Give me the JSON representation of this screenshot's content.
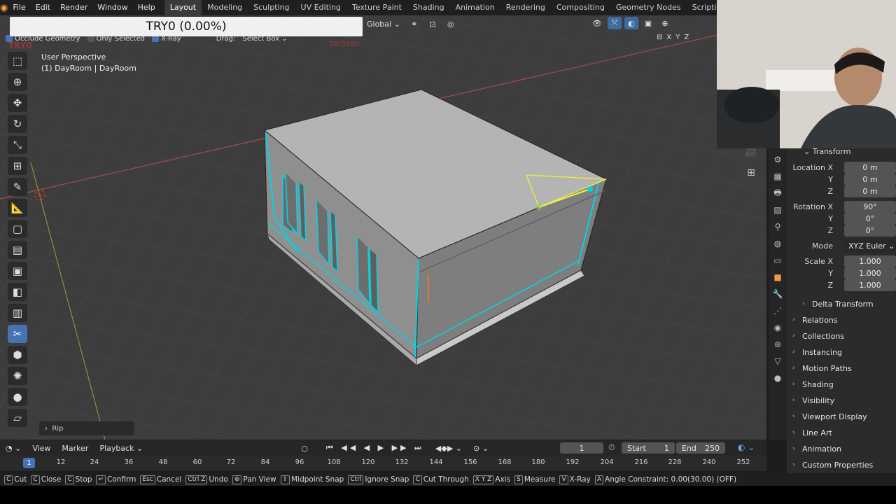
{
  "menu": {
    "items": [
      "File",
      "Edit",
      "Render",
      "Window",
      "Help"
    ],
    "workspaces": [
      "Layout",
      "Modeling",
      "Sculpting",
      "UV Editing",
      "Texture Paint",
      "Shading",
      "Animation",
      "Rendering",
      "Compositing",
      "Geometry Nodes",
      "Scripting"
    ],
    "active_workspace": "Layout"
  },
  "header": {
    "transform_orientation": "Global"
  },
  "tool_options": {
    "occlude_geometry": "Occlude Geometry",
    "only_selected": "Only Selected",
    "xray": "X-Ray",
    "drag_label": "Drag:",
    "drag_value": "Select Box"
  },
  "progress": {
    "text": "TRY0 (0.00%)"
  },
  "overlay_text": {
    "left": "TRY0",
    "center": "TRY2500"
  },
  "viewport": {
    "view_name": "User Perspective",
    "object_info": "(1) DayRoom | DayRoom",
    "redo_panel": "Rip",
    "axis_buttons": [
      "X",
      "Y",
      "Z"
    ]
  },
  "properties": {
    "transform_header": "Transform",
    "location": {
      "label": "Location X",
      "x": "0 m",
      "y": "0 m",
      "z": "0 m"
    },
    "rotation": {
      "label": "Rotation X",
      "x": "90°",
      "y": "0°",
      "z": "0°"
    },
    "mode": {
      "label": "Mode",
      "value": "XYZ Euler"
    },
    "scale": {
      "label": "Scale X",
      "x": "1.000",
      "y": "1.000",
      "z": "1.000"
    },
    "axis_y": "Y",
    "axis_z": "Z",
    "sections": [
      "Delta Transform",
      "Relations",
      "Collections",
      "Instancing",
      "Motion Paths",
      "Shading",
      "Visibility",
      "Viewport Display",
      "Line Art",
      "Animation",
      "Custom Properties"
    ]
  },
  "timeline": {
    "menus": [
      "View",
      "Marker",
      "Playback"
    ],
    "current_frame": "1",
    "start_label": "Start",
    "start": "1",
    "end_label": "End",
    "end": "250",
    "ruler": [
      "12",
      "24",
      "36",
      "48",
      "60",
      "72",
      "84",
      "96",
      "108",
      "120",
      "132",
      "144",
      "156",
      "168",
      "180",
      "192",
      "204",
      "216",
      "228",
      "240",
      "252"
    ],
    "ruler_marker": "1"
  },
  "statusbar": [
    {
      "key": "C",
      "label": "Cut"
    },
    {
      "key": "C",
      "label": "Close"
    },
    {
      "key": "C",
      "label": "Stop"
    },
    {
      "key": "↵",
      "label": "Confirm"
    },
    {
      "key": "Esc",
      "label": "Cancel"
    },
    {
      "key": "Ctrl Z",
      "label": "Undo"
    },
    {
      "key": "⊕",
      "label": "Pan View"
    },
    {
      "key": "⇧",
      "label": "Midpoint Snap"
    },
    {
      "key": "Ctrl",
      "label": "Ignore Snap"
    },
    {
      "key": "C",
      "label": "Cut Through"
    },
    {
      "key": "X Y Z",
      "label": "Axis"
    },
    {
      "key": "S",
      "label": "Measure"
    },
    {
      "key": "V",
      "label": "X-Ray"
    },
    {
      "key": "A",
      "label": "Angle Constraint: 0.00(30.00) (OFF)"
    }
  ],
  "colors": {
    "accent": "#4772b3",
    "selection": "#00d5e5",
    "knife_line": "#e8e84a",
    "viewport_bg": "#3d3d3d"
  }
}
